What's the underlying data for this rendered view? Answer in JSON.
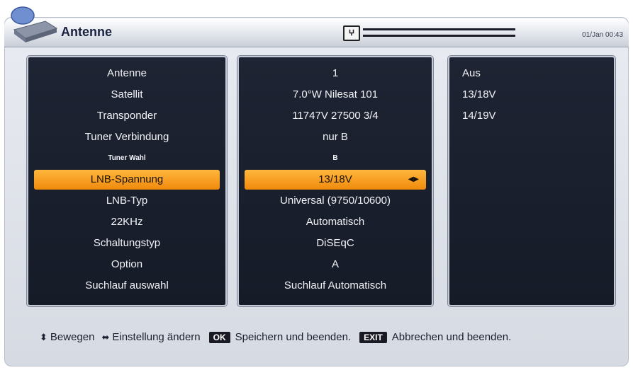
{
  "header": {
    "title": "Antenne",
    "signal_icon": "satellite-signal-icon",
    "clock": "01/Jan 00:43"
  },
  "labels": [
    "Antenne",
    "Satellit",
    "Transponder",
    "Tuner Verbindung",
    "Tuner Wahl",
    "LNB-Spannung",
    "LNB-Typ",
    "22KHz",
    "Schaltungstyp",
    "Option",
    "Suchlauf auswahl"
  ],
  "values": [
    "1",
    "7.0°W Nilesat 101",
    "11747V 27500 3/4",
    "nur B",
    "B",
    "13/18V",
    "Universal (9750/10600)",
    "Automatisch",
    "DiSEqC",
    "A",
    "Suchlauf Automatisch"
  ],
  "options": [
    "Aus",
    "13/18V",
    "14/19V"
  ],
  "selected_index": 5,
  "footer": {
    "move": "Bewegen",
    "change": "Einstellung ändern",
    "ok_key": "OK",
    "ok_text": "Speichern und beenden.",
    "exit_key": "EXIT",
    "exit_text": "Abbrechen und beenden."
  },
  "colors": {
    "accent": "#f59a1a",
    "panel": "#1a1f2d"
  }
}
